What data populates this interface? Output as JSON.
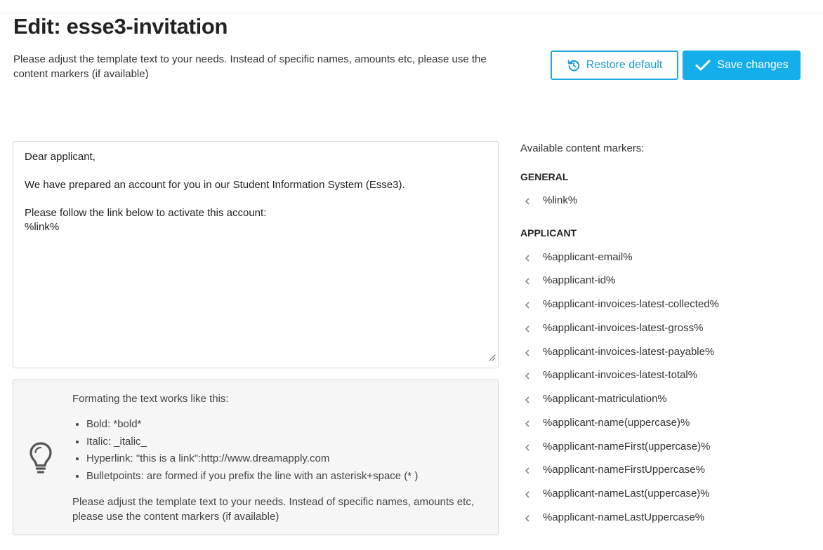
{
  "page": {
    "title": "Edit: esse3-invitation",
    "intro": "Please adjust the template text to your needs. Instead of specific names, amounts etc, please use the content markers (if available)"
  },
  "actions": {
    "restore_label": "Restore default",
    "save_label": "Save changes"
  },
  "editor": {
    "lines": [
      "Dear applicant,",
      "",
      "We have prepared an account for you in our Student Information System (Esse3).",
      "",
      "Please follow the link below to activate this account:",
      "%link%"
    ]
  },
  "help": {
    "heading": "Formating the text works like this:",
    "items": [
      "Bold: *bold*",
      "Italic: _italic_",
      "Hyperlink: \"this is a link\":http://www.dreamapply.com",
      "Bulletpoints: are formed if you prefix the line with an asterisk+space (* )"
    ],
    "footer": "Please adjust the template text to your needs. Instead of specific names, amounts etc, please use the content markers (if available)",
    "icon": "lightbulb-icon"
  },
  "markers": {
    "title": "Available content markers:",
    "sections": [
      {
        "name": "GENERAL",
        "items": [
          "%link%"
        ]
      },
      {
        "name": "APPLICANT",
        "items": [
          "%applicant-email%",
          "%applicant-id%",
          "%applicant-invoices-latest-collected%",
          "%applicant-invoices-latest-gross%",
          "%applicant-invoices-latest-payable%",
          "%applicant-invoices-latest-total%",
          "%applicant-matriculation%",
          "%applicant-name(uppercase)%",
          "%applicant-nameFirst(uppercase)%",
          "%applicant-nameFirstUppercase%",
          "%applicant-nameLast(uppercase)%",
          "%applicant-nameLastUppercase%"
        ]
      }
    ]
  },
  "colors": {
    "accent": "#14aeea",
    "accent_border": "#1fa7e0",
    "panel_bg": "#f6f6f6"
  }
}
